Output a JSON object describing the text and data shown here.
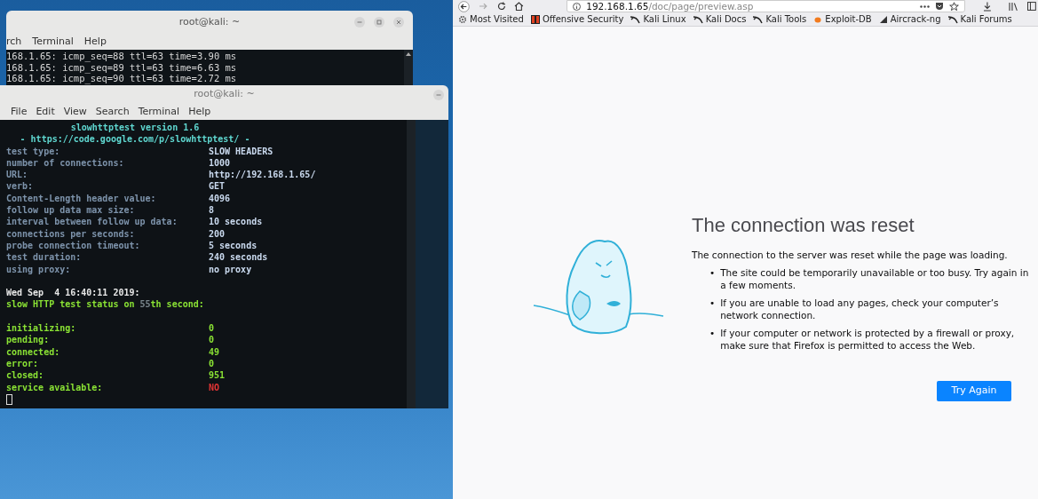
{
  "desktop": {
    "back_terminal": {
      "title": "root@kali: ~",
      "menu": [
        "rch",
        "Terminal",
        "Help"
      ],
      "lines": [
        "168.1.65: icmp_seq=88 ttl=63 time=3.90 ms",
        "168.1.65: icmp_seq=89 ttl=63 time=6.63 ms",
        "168.1.65: icmp_seq=90 ttl=63 time=2.72 ms"
      ]
    },
    "front_terminal": {
      "title": "root@kali: ~",
      "menu": [
        "File",
        "Edit",
        "View",
        "Search",
        "Terminal",
        "Help"
      ],
      "lines": [
        {
          "kind": "banner",
          "segments": [
            {
              "text": "slowhttptest version 1.6",
              "color": "#5fd7d0"
            }
          ]
        },
        {
          "kind": "banner",
          "segments": [
            {
              "text": "- https://code.google.com/p/slowhttptest/ -",
              "color": "#5fd7d0"
            }
          ]
        },
        {
          "kind": "pair",
          "segments": [
            {
              "text": "test type:",
              "color": "#7d93ab"
            },
            {
              "text": "SLOW HEADERS",
              "color": "#c9d9ee"
            }
          ]
        },
        {
          "kind": "pair",
          "segments": [
            {
              "text": "number of connections:",
              "color": "#7d93ab"
            },
            {
              "text": "1000",
              "color": "#c9d9ee"
            }
          ]
        },
        {
          "kind": "pair",
          "segments": [
            {
              "text": "URL:",
              "color": "#7d93ab"
            },
            {
              "text": "http://192.168.1.65/",
              "color": "#c9d9ee"
            }
          ]
        },
        {
          "kind": "pair",
          "segments": [
            {
              "text": "verb:",
              "color": "#7d93ab"
            },
            {
              "text": "GET",
              "color": "#c9d9ee"
            }
          ]
        },
        {
          "kind": "pair",
          "segments": [
            {
              "text": "Content-Length header value:",
              "color": "#7d93ab"
            },
            {
              "text": "4096",
              "color": "#c9d9ee"
            }
          ]
        },
        {
          "kind": "pair",
          "segments": [
            {
              "text": "follow up data max size:",
              "color": "#7d93ab"
            },
            {
              "text": "8",
              "color": "#c9d9ee"
            }
          ]
        },
        {
          "kind": "pair",
          "segments": [
            {
              "text": "interval between follow up data:",
              "color": "#7d93ab"
            },
            {
              "text": "10 seconds",
              "color": "#c9d9ee"
            }
          ]
        },
        {
          "kind": "pair",
          "segments": [
            {
              "text": "connections per seconds:",
              "color": "#7d93ab"
            },
            {
              "text": "200",
              "color": "#c9d9ee"
            }
          ]
        },
        {
          "kind": "pair",
          "segments": [
            {
              "text": "probe connection timeout:",
              "color": "#7d93ab"
            },
            {
              "text": "5 seconds",
              "color": "#c9d9ee"
            }
          ]
        },
        {
          "kind": "pair",
          "segments": [
            {
              "text": "test duration:",
              "color": "#7d93ab"
            },
            {
              "text": "240 seconds",
              "color": "#c9d9ee"
            }
          ]
        },
        {
          "kind": "pair",
          "segments": [
            {
              "text": "using proxy:",
              "color": "#7d93ab"
            },
            {
              "text": "no proxy",
              "color": "#c9d9ee"
            }
          ]
        },
        {
          "kind": "blank"
        },
        {
          "kind": "text",
          "segments": [
            {
              "text": "Wed Sep  4 16:40:11 2019:",
              "color": "#e8e8e8"
            }
          ]
        },
        {
          "kind": "text",
          "segments": [
            {
              "text": "slow HTTP test status on ",
              "color": "#8ae234"
            },
            {
              "text": "55",
              "color": "#7a868c"
            },
            {
              "text": "th second:",
              "color": "#8ae234"
            }
          ]
        },
        {
          "kind": "blank"
        },
        {
          "kind": "pair",
          "segments": [
            {
              "text": "initializing:",
              "color": "#8ae234"
            },
            {
              "text": "0",
              "color": "#8ae234"
            }
          ]
        },
        {
          "kind": "pair",
          "segments": [
            {
              "text": "pending:",
              "color": "#8ae234"
            },
            {
              "text": "0",
              "color": "#8ae234"
            }
          ]
        },
        {
          "kind": "pair",
          "segments": [
            {
              "text": "connected:",
              "color": "#8ae234"
            },
            {
              "text": "49",
              "color": "#8ae234"
            }
          ]
        },
        {
          "kind": "pair",
          "segments": [
            {
              "text": "error:",
              "color": "#8ae234"
            },
            {
              "text": "0",
              "color": "#8ae234"
            }
          ]
        },
        {
          "kind": "pair",
          "segments": [
            {
              "text": "closed:",
              "color": "#8ae234"
            },
            {
              "text": "951",
              "color": "#8ae234"
            }
          ]
        },
        {
          "kind": "pair",
          "segments": [
            {
              "text": "service available:",
              "color": "#8ae234"
            },
            {
              "text": "NO",
              "color": "#e03434"
            }
          ]
        },
        {
          "kind": "cursor"
        }
      ]
    }
  },
  "browser": {
    "url_host": "192.168.1.65",
    "url_path": "/doc/page/preview.asp",
    "bookmarks": [
      {
        "label": "Most Visited",
        "kind": "gear"
      },
      {
        "label": "Offensive Security",
        "kind": "offsec"
      },
      {
        "label": "Kali Linux",
        "kind": "kali"
      },
      {
        "label": "Kali Docs",
        "kind": "kali"
      },
      {
        "label": "Kali Tools",
        "kind": "kali"
      },
      {
        "label": "Exploit-DB",
        "kind": "exploit"
      },
      {
        "label": "Aircrack-ng",
        "kind": "aircrack"
      },
      {
        "label": "Kali Forums",
        "kind": "kali"
      }
    ],
    "error": {
      "title": "The connection was reset",
      "message": "The connection to the server was reset while the page was loading.",
      "bullets": [
        {
          "marker": "•",
          "text": "The site could be temporarily unavailable or too busy. Try again in a few moments."
        },
        {
          "marker": "•",
          "text": "If you are unable to load any pages, check your computer’s network connection."
        },
        {
          "marker": "•",
          "text": "If your computer or network is protected by a firewall or proxy, make sure that Firefox is permitted to access the Web."
        }
      ],
      "button": "Try Again"
    }
  }
}
